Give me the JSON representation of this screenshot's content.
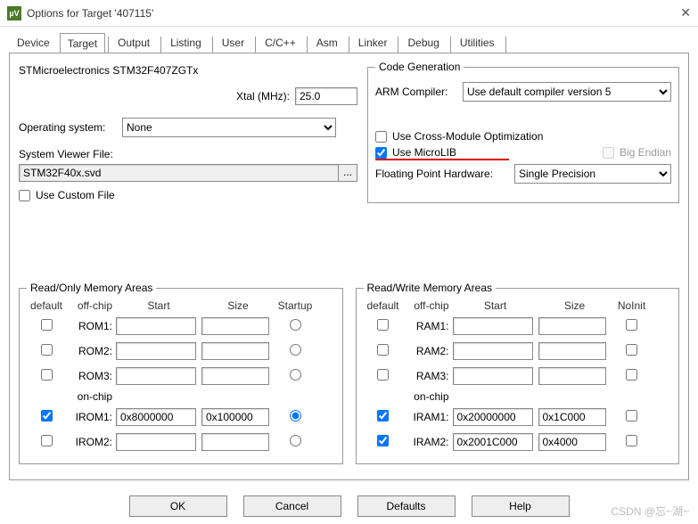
{
  "window": {
    "title": "Options for Target '407115'"
  },
  "tabs": [
    "Device",
    "Target",
    "Output",
    "Listing",
    "User",
    "C/C++",
    "Asm",
    "Linker",
    "Debug",
    "Utilities"
  ],
  "active_tab": 1,
  "target": {
    "device_name": "STMicroelectronics STM32F407ZGTx",
    "xtal_label": "Xtal (MHz):",
    "xtal_value": "25.0",
    "os_label": "Operating system:",
    "os_value": "None",
    "svf_label": "System Viewer File:",
    "svf_value": "STM32F40x.svd",
    "use_custom_file": "Use Custom File"
  },
  "codegen": {
    "legend": "Code Generation",
    "arm_compiler_label": "ARM Compiler:",
    "arm_compiler_value": "Use default compiler version 5",
    "cross_module": "Use Cross-Module Optimization",
    "microlib": "Use MicroLIB",
    "big_endian": "Big Endian",
    "fph_label": "Floating Point Hardware:",
    "fph_value": "Single Precision"
  },
  "ro": {
    "legend": "Read/Only Memory Areas",
    "hdr": {
      "default": "default",
      "off": "off-chip",
      "start": "Start",
      "size": "Size",
      "last": "Startup"
    },
    "onchip": "on-chip",
    "rows": [
      {
        "label": "ROM1:",
        "start": "",
        "size": "",
        "def": false,
        "sel": false
      },
      {
        "label": "ROM2:",
        "start": "",
        "size": "",
        "def": false,
        "sel": false
      },
      {
        "label": "ROM3:",
        "start": "",
        "size": "",
        "def": false,
        "sel": false
      },
      {
        "label": "IROM1:",
        "start": "0x8000000",
        "size": "0x100000",
        "def": true,
        "sel": true
      },
      {
        "label": "IROM2:",
        "start": "",
        "size": "",
        "def": false,
        "sel": false
      }
    ]
  },
  "rw": {
    "legend": "Read/Write Memory Areas",
    "hdr": {
      "default": "default",
      "off": "off-chip",
      "start": "Start",
      "size": "Size",
      "last": "NoInit"
    },
    "onchip": "on-chip",
    "rows": [
      {
        "label": "RAM1:",
        "start": "",
        "size": "",
        "def": false,
        "ni": false
      },
      {
        "label": "RAM2:",
        "start": "",
        "size": "",
        "def": false,
        "ni": false
      },
      {
        "label": "RAM3:",
        "start": "",
        "size": "",
        "def": false,
        "ni": false
      },
      {
        "label": "IRAM1:",
        "start": "0x20000000",
        "size": "0x1C000",
        "def": true,
        "ni": false
      },
      {
        "label": "IRAM2:",
        "start": "0x2001C000",
        "size": "0x4000",
        "def": true,
        "ni": false
      }
    ]
  },
  "buttons": {
    "ok": "OK",
    "cancel": "Cancel",
    "defaults": "Defaults",
    "help": "Help"
  },
  "watermark": "CSDN @忘~湖~"
}
